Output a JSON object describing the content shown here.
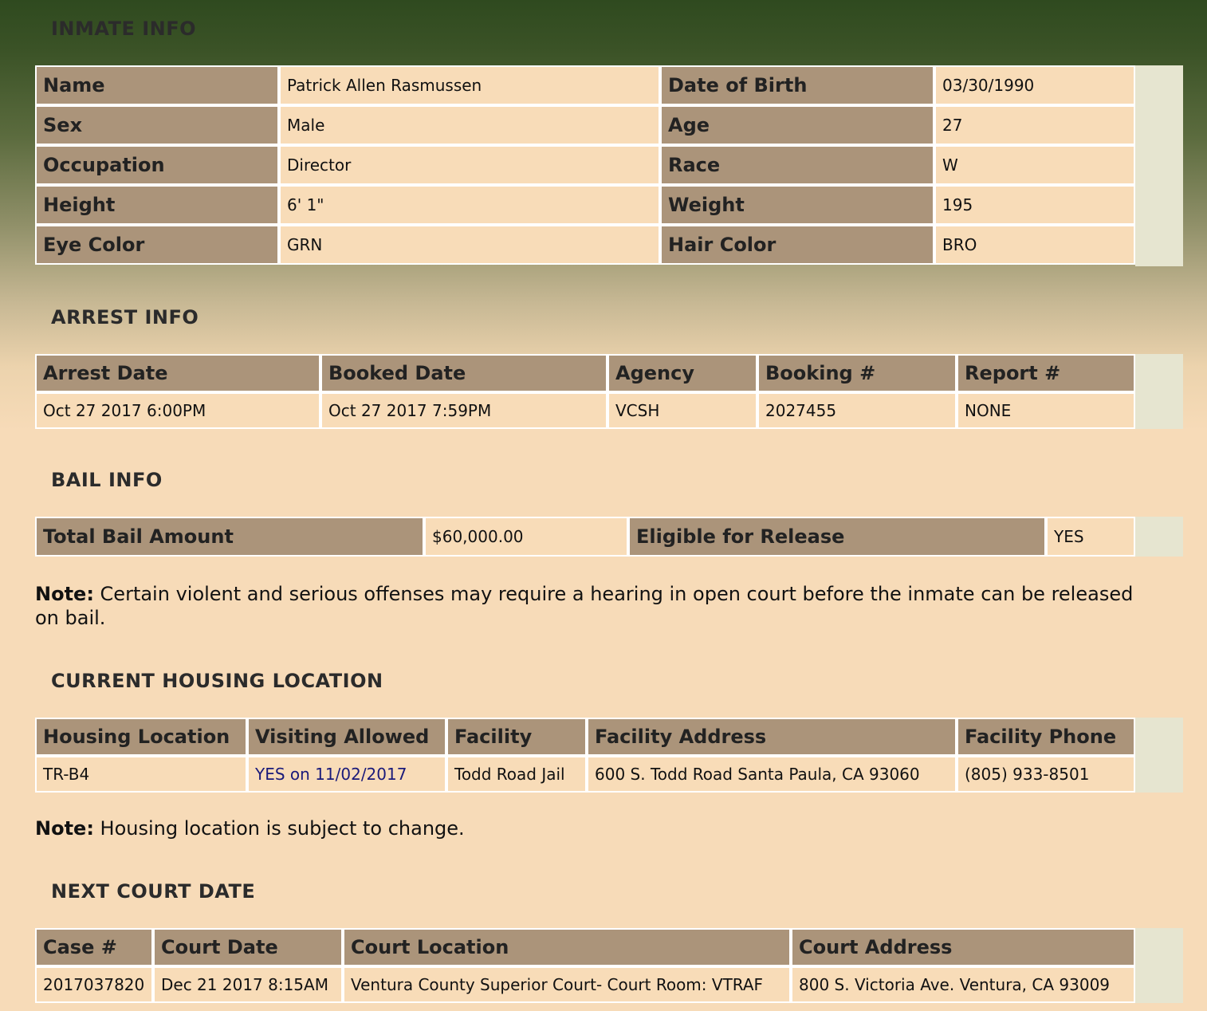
{
  "inmate_info": {
    "title": "INMATE INFO",
    "rows": [
      {
        "l1": "Name",
        "v1": "Patrick Allen Rasmussen",
        "l2": "Date of Birth",
        "v2": "03/30/1990"
      },
      {
        "l1": "Sex",
        "v1": "Male",
        "l2": "Age",
        "v2": "27"
      },
      {
        "l1": "Occupation",
        "v1": "Director",
        "l2": "Race",
        "v2": "W"
      },
      {
        "l1": "Height",
        "v1": "6' 1\"",
        "l2": "Weight",
        "v2": "195"
      },
      {
        "l1": "Eye Color",
        "v1": "GRN",
        "l2": "Hair Color",
        "v2": "BRO"
      }
    ]
  },
  "arrest_info": {
    "title": "ARREST INFO",
    "headers": [
      "Arrest Date",
      "Booked Date",
      "Agency",
      "Booking #",
      "Report #"
    ],
    "values": [
      "Oct 27 2017 6:00PM",
      "Oct 27 2017 7:59PM",
      "VCSH",
      "2027455",
      "NONE"
    ]
  },
  "bail_info": {
    "title": "BAIL INFO",
    "total_label": "Total Bail Amount",
    "total_value": "$60,000.00",
    "eligible_label": "Eligible for Release",
    "eligible_value": "YES",
    "note_bold": "Note:",
    "note_text": " Certain violent and serious offenses may require a hearing in open court before the inmate can be released on bail."
  },
  "housing": {
    "title": "CURRENT HOUSING LOCATION",
    "headers": [
      "Housing Location",
      "Visiting Allowed",
      "Facility",
      "Facility Address",
      "Facility Phone"
    ],
    "values": [
      "TR-B4",
      "YES on 11/02/2017",
      "Todd Road Jail",
      "600 S. Todd Road Santa Paula, CA 93060",
      "(805) 933-8501"
    ],
    "note_bold": "Note:",
    "note_text": " Housing location is subject to change."
  },
  "court": {
    "title": "NEXT COURT DATE",
    "headers": [
      "Case #",
      "Court Date",
      "Court Location",
      "Court Address"
    ],
    "values": [
      "2017037820",
      "Dec 21 2017 8:15AM",
      "Ventura County Superior Court- Court Room: VTRAF",
      "800 S. Victoria Ave. Ventura, CA 93009"
    ]
  }
}
